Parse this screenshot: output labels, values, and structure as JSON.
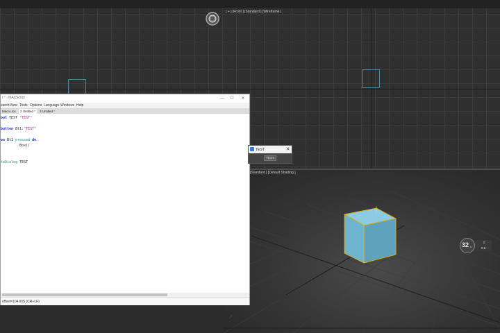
{
  "viewports": {
    "front": {
      "label": "[ + ] [Front ] [Standard ] [Wireframe ]"
    },
    "perspective": {
      "label": "[Standard ] [Default Shading ]"
    }
  },
  "maxscript_editor": {
    "title": "t * - MAXScript",
    "menu": [
      "earch",
      "View",
      "Tools",
      "Options",
      "Language",
      "Windows",
      "Help"
    ],
    "tabs": [
      {
        "label": "Macro.ms",
        "active": false
      },
      {
        "label": "2 Untitled *",
        "active": true
      },
      {
        "label": "3 Untitled *",
        "active": false
      }
    ],
    "code": [
      {
        "parts": [
          {
            "t": "out ",
            "c": "kw"
          },
          {
            "t": "TEST ",
            "c": "plain"
          },
          {
            "t": "\"TEST\"",
            "c": "str"
          }
        ]
      },
      {
        "parts": []
      },
      {
        "parts": [
          {
            "t": "button ",
            "c": "kw"
          },
          {
            "t": "Bt1:",
            "c": "plain"
          },
          {
            "t": "\"TEST\"",
            "c": "str"
          }
        ]
      },
      {
        "parts": []
      },
      {
        "parts": [
          {
            "t": "on ",
            "c": "kw"
          },
          {
            "t": "Bt1 ",
            "c": "plain"
          },
          {
            "t": "pressed ",
            "c": "fn"
          },
          {
            "t": "do",
            "c": "kw"
          }
        ]
      },
      {
        "parts": [
          {
            "t": "         Box()",
            "c": "plain"
          }
        ]
      },
      {
        "parts": []
      },
      {
        "parts": []
      },
      {
        "parts": [
          {
            "t": "teDialog ",
            "c": "fn"
          },
          {
            "t": "TEST",
            "c": "plain"
          }
        ]
      }
    ],
    "status": "offset=104 INS (CR+LF)",
    "window_buttons": {
      "minimize": "—",
      "maximize": "☐",
      "close": "✕"
    }
  },
  "test_dialog": {
    "title": "TEST",
    "button_label": "TEST",
    "close_glyph": "✕"
  },
  "gauge": {
    "value": "32",
    "unit": "s",
    "line1": "0",
    "line2": "0.6"
  },
  "colors": {
    "box_fill": "#6fb4cf",
    "selection": "#d9a514",
    "keyword": "#1a33b0",
    "string": "#b32a8a"
  }
}
